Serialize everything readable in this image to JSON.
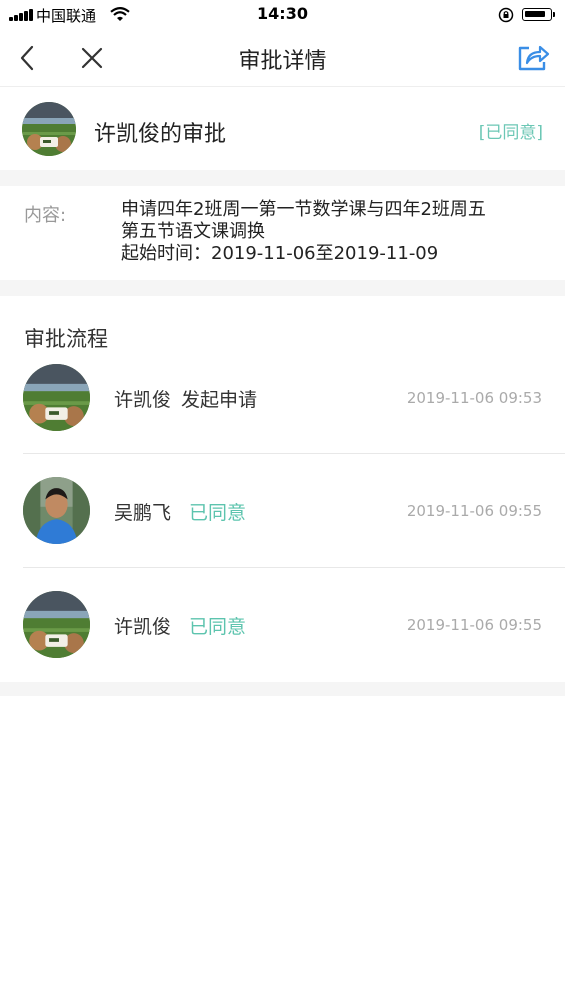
{
  "status_bar": {
    "carrier": "中国联通",
    "time": "14:30"
  },
  "nav": {
    "title": "审批详情"
  },
  "header": {
    "applicant_title": "许凯俊的审批",
    "status": "[已同意]"
  },
  "content": {
    "label": "内容:",
    "line1": "申请四年2班周一第一节数学课与四年2班周五",
    "line2": "第五节语文课调换",
    "line3": "起始时间：2019-11-06至2019-11-09"
  },
  "flow": {
    "title": "审批流程",
    "steps": [
      {
        "name": "许凯俊",
        "action": "发起申请",
        "time": "2019-11-06 09:53",
        "avatar": "football-avatar"
      },
      {
        "name": "吴鹏飞",
        "action": "已同意",
        "time": "2019-11-06 09:55",
        "avatar": "person-avatar"
      },
      {
        "name": "许凯俊",
        "action": "已同意",
        "time": "2019-11-06 09:55",
        "avatar": "football-avatar"
      }
    ]
  },
  "colors": {
    "accent_green": "#5dc4ae",
    "share_blue": "#3a8ee6",
    "gray_bg": "#f5f5f5"
  }
}
